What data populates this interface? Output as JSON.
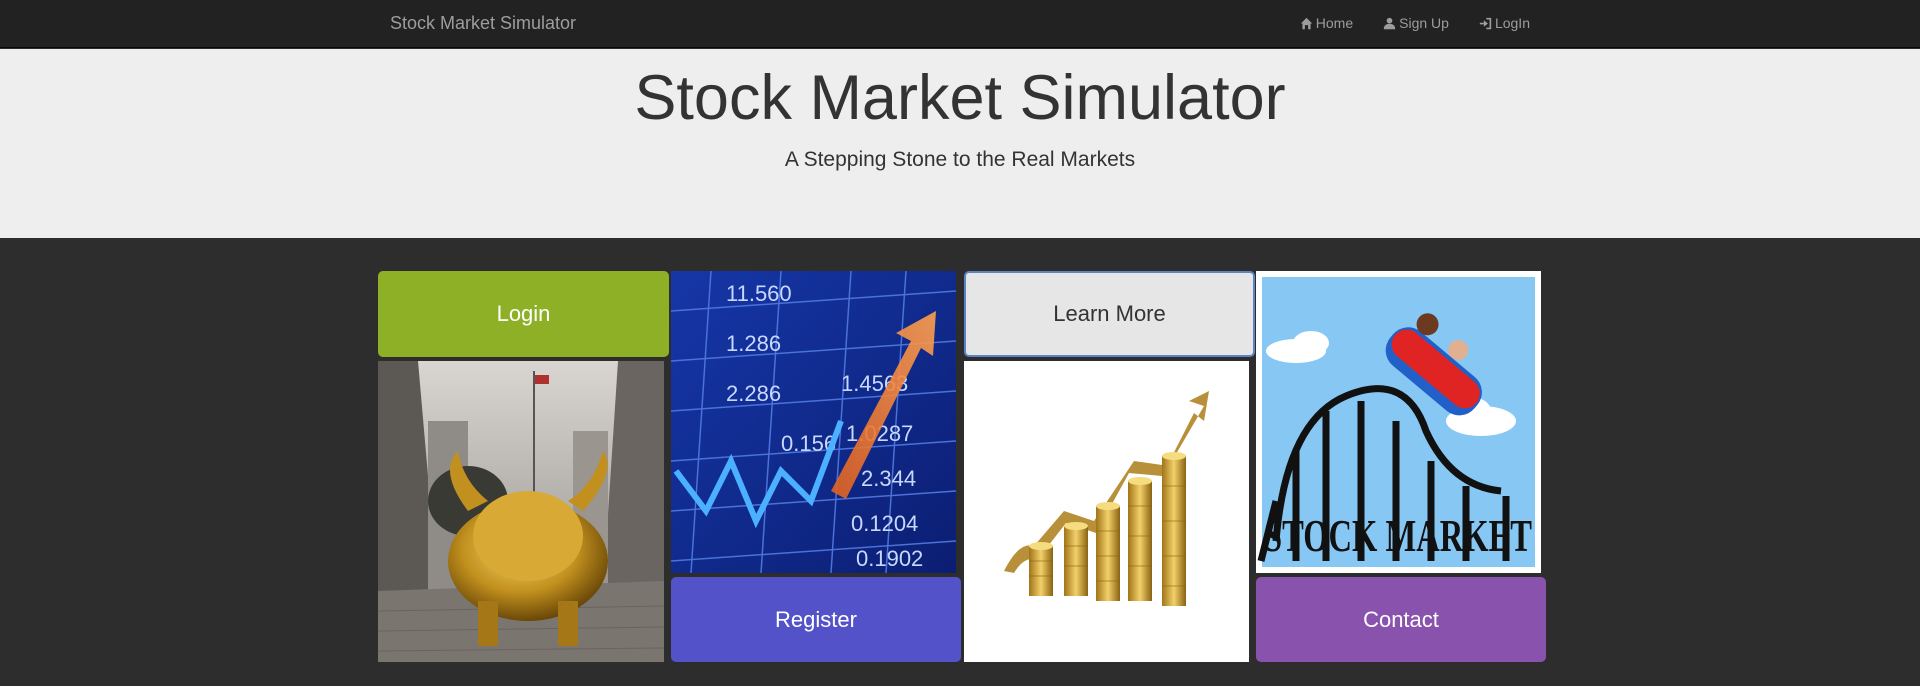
{
  "navbar": {
    "brand": "Stock Market Simulator",
    "links": [
      {
        "label": "Home",
        "icon": "home-icon"
      },
      {
        "label": "Sign Up",
        "icon": "user-icon"
      },
      {
        "label": "LogIn",
        "icon": "log-in-icon"
      }
    ]
  },
  "jumbotron": {
    "title": "Stock Market Simulator",
    "subtitle": "A Stepping Stone to the Real Markets"
  },
  "tiles": {
    "login_label": "Login",
    "register_label": "Register",
    "learn_more_label": "Learn More",
    "contact_label": "Contact"
  },
  "images": {
    "coaster_text": "STOCK MARKET"
  },
  "colors": {
    "login": "#8eb026",
    "register": "#5352c9",
    "learn_more": "#e6e6e6",
    "contact": "#8952ad"
  }
}
